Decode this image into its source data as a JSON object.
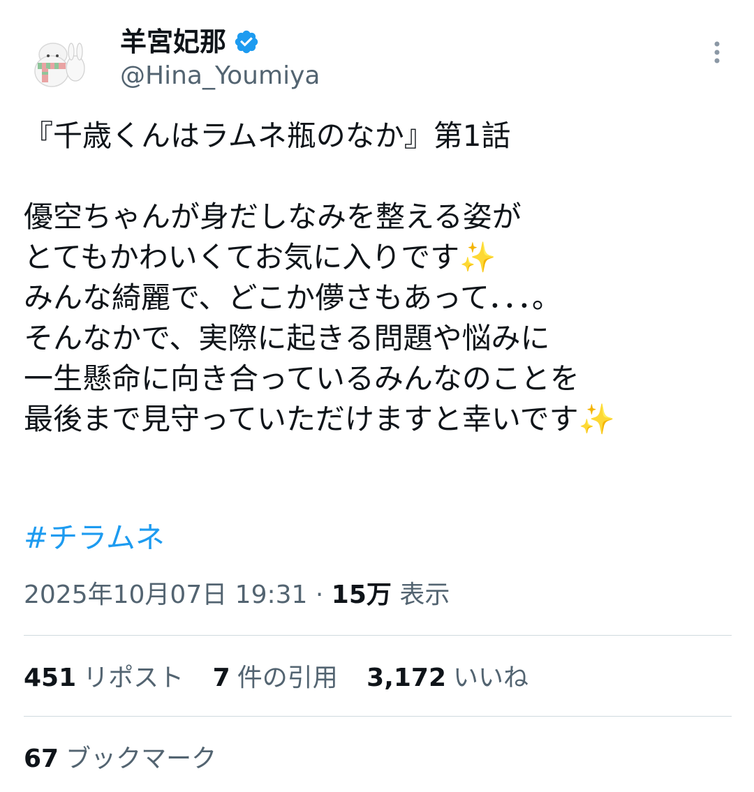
{
  "author": {
    "display_name": "羊宮妃那",
    "handle": "@Hina_Youmiya",
    "verified": true,
    "avatar_icon": "sheep-avatar-icon"
  },
  "tweet": {
    "text": "『千歳くんはラムネ瓶のなか』第1話\n\n優空ちゃんが身だしなみを整える姿が\nとてもかわいくてお気に入りです✨\nみんな綺麗で、どこか儚さもあって．．．。\nそんなかで、実際に起きる問題や悩みに\n一生懸命に向き合っているみんなのことを\n最後まで見守っていただけますと幸いです✨",
    "hashtag": "#チラムネ",
    "timestamp": "2025年10月07日 19:31",
    "separator": " · ",
    "views_count": "15万",
    "views_label": " 表示"
  },
  "stats": {
    "reposts": {
      "count": "451",
      "label": "リポスト"
    },
    "quotes": {
      "count": "7",
      "label": "件の引用"
    },
    "likes": {
      "count": "3,172",
      "label": "いいね"
    },
    "bookmarks": {
      "count": "67",
      "label": "ブックマーク"
    }
  },
  "colors": {
    "text": "#0f1419",
    "secondary": "#536471",
    "link": "#1d9bf0",
    "verified": "#1d9bf0",
    "divider": "#cfd9de"
  },
  "icons": {
    "verified": "verified-badge-icon",
    "more": "more-options-icon"
  }
}
